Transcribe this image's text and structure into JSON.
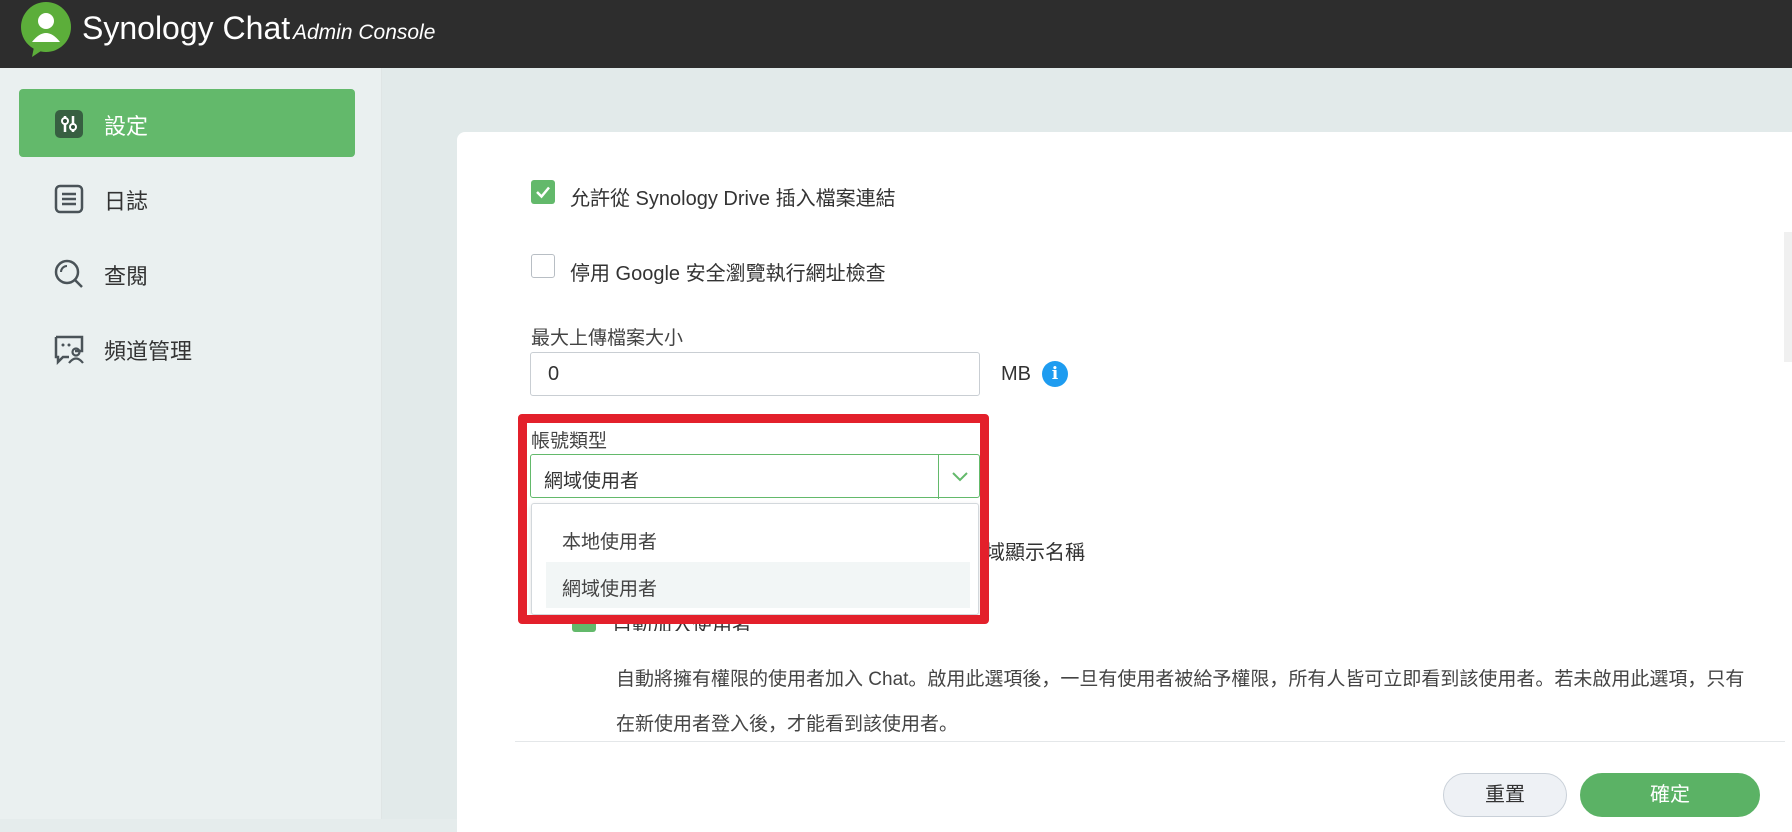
{
  "header": {
    "app_name": "Synology Chat",
    "app_subtitle": "Admin Console",
    "logo_icon": "chat-user-logo-icon"
  },
  "sidebar": {
    "items": [
      {
        "label": "設定",
        "icon": "settings-sliders-icon",
        "active": true
      },
      {
        "label": "日誌",
        "icon": "log-list-icon",
        "active": false
      },
      {
        "label": "查閱",
        "icon": "search-icon",
        "active": false
      },
      {
        "label": "頻道管理",
        "icon": "channel-management-icon",
        "active": false
      }
    ]
  },
  "settings": {
    "allow_drive_links": {
      "label": "允許從 Synology Drive 插入檔案連結",
      "checked": true
    },
    "disable_google_safe_browsing": {
      "label": "停用 Google 安全瀏覽執行網址檢查",
      "checked": false
    },
    "max_upload": {
      "label": "最大上傳檔案大小",
      "value": "0",
      "unit": "MB",
      "info_icon": "info-icon"
    },
    "account_type": {
      "label": "帳號類型",
      "selected": "網域使用者",
      "options": [
        "本地使用者",
        "網域使用者"
      ]
    },
    "display_name_partial": "域顯示名稱",
    "auto_add_users": {
      "label_partial": "自動加入使用者",
      "checked": true,
      "description_line1": "自動將擁有權限的使用者加入 Chat。啟用此選項後，一旦有使用者被給予權限，所有人皆可立即看到該使用者。若未啟用此選項，只有",
      "description_line2": "在新使用者登入後，才能看到該使用者。"
    }
  },
  "footer": {
    "reset_label": "重置",
    "ok_label": "確定"
  },
  "colors": {
    "accent": "#63b96b",
    "highlight": "#e3202b",
    "info": "#1e9cf0",
    "topbar": "#2d2d2d"
  }
}
